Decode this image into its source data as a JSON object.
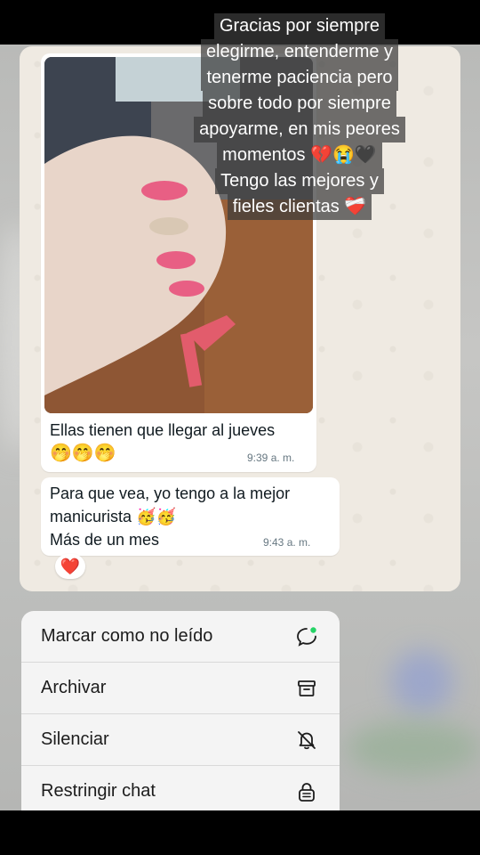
{
  "overlay_caption": {
    "lines": [
      "Gracias por siempre",
      "elegirme, entenderme y",
      "tenerme paciencia pero",
      "sobre todo por siempre",
      "apoyarme, en mis peores",
      "momentos 💔😭🖤",
      "Tengo las mejores y",
      "fieles clientas ❤️‍🩹"
    ]
  },
  "chat": {
    "messages": [
      {
        "text": "Ellas tienen que llegar al jueves",
        "emojis": "🤭🤭🤭",
        "time": "9:39 a. m."
      },
      {
        "text_line1": "Para que vea, yo tengo a la mejor",
        "text_line2": "manicurista 🥳🥳",
        "text_line3": "Más de un mes",
        "time": "9:43 a. m."
      }
    ],
    "reaction": "❤️"
  },
  "menu": {
    "items": [
      {
        "label": "Marcar como no leído",
        "icon": "mark-unread-icon"
      },
      {
        "label": "Archivar",
        "icon": "archive-icon"
      },
      {
        "label": "Silenciar",
        "icon": "mute-icon"
      },
      {
        "label": "Restringir chat",
        "icon": "lock-chat-icon"
      }
    ]
  },
  "colors": {
    "accent_green": "#25d366",
    "bubble": "#ffffff",
    "chat_bg": "#efeae2"
  }
}
